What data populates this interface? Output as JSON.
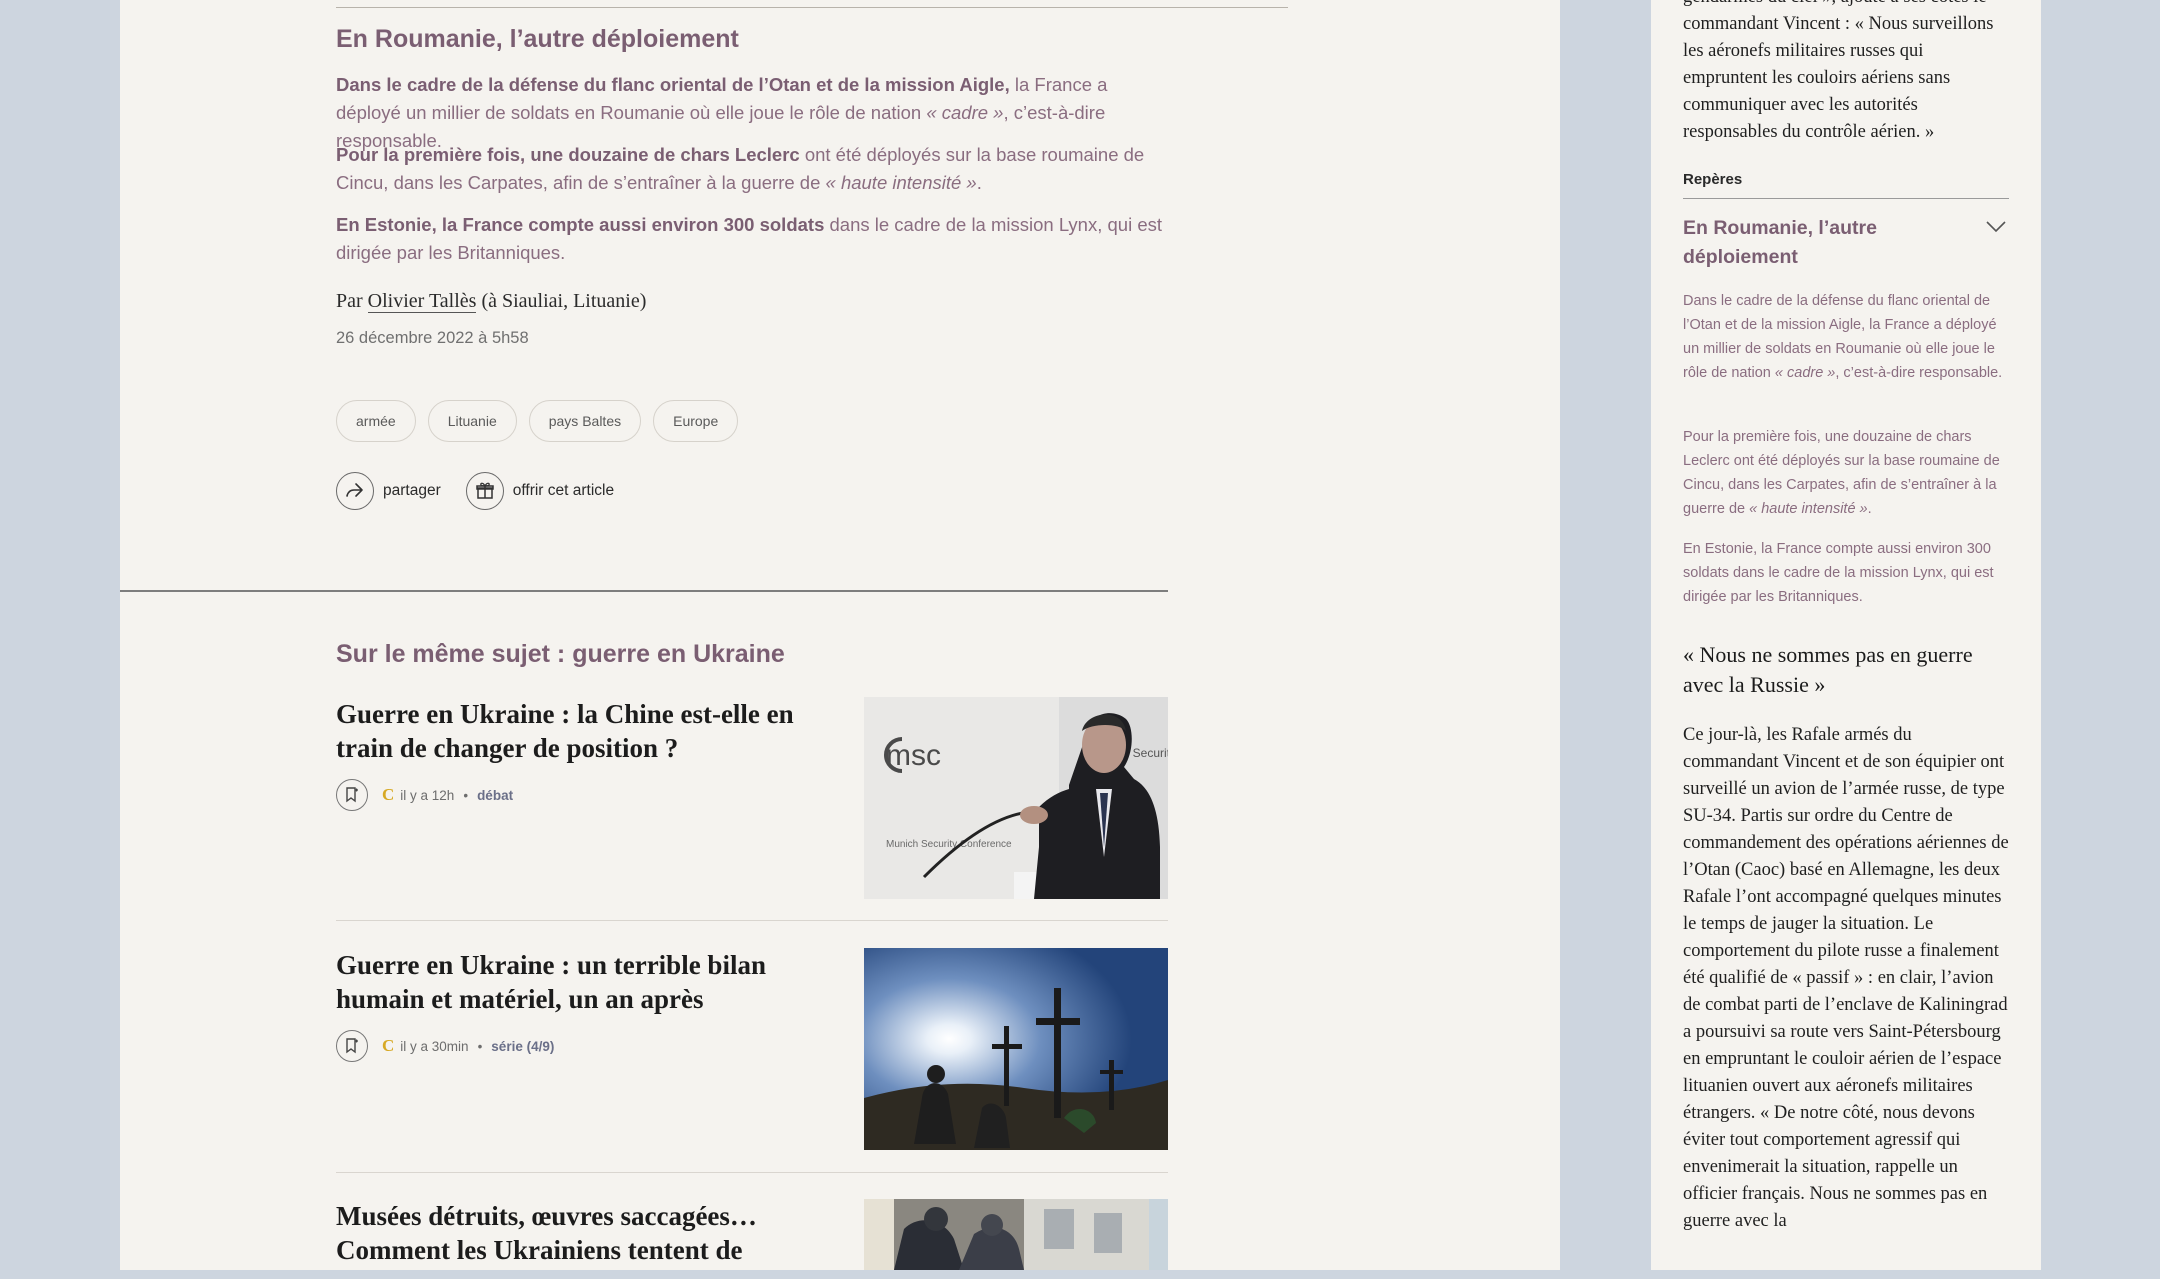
{
  "article": {
    "section_title": "En Roumanie, l’autre déploiement",
    "paragraphs": [
      {
        "bold": "Dans le cadre de la défense du flanc oriental de l’Otan et de la mission Aigle,",
        "pre": " la France a déployé un millier de soldats en Roumanie où elle joue le rôle de nation ",
        "em": "« cadre »",
        "post": ", c’est-à-dire responsable."
      },
      {
        "bold": "Pour la première fois, une douzaine de chars Leclerc",
        "pre": " ont été déployés sur la base roumaine de Cincu, dans les Carpates, afin de s’entraîner à la guerre de ",
        "em": "« haute intensité »",
        "post": "."
      },
      {
        "bold": "En Estonie, la France compte aussi environ 300 soldats",
        "pre": " dans le cadre de la mission Lynx, qui est dirigée par les Britanniques.",
        "em": "",
        "post": ""
      }
    ],
    "byline_prefix": "Par",
    "author": "Olivier Tallès",
    "byline_suffix": "(à Siauliai, Lituanie)",
    "date": "26 décembre 2022 à 5h58",
    "tags": [
      "armée",
      "Lituanie",
      "pays Baltes",
      "Europe"
    ],
    "share_label": "partager",
    "gift_label": "offrir cet article"
  },
  "related": {
    "title": "Sur le même sujet : guerre en Ukraine",
    "items": [
      {
        "title": "Guerre en Ukraine : la Chine est-elle en train de changer de position ?",
        "time": "il y a 12h",
        "kind": "débat",
        "brand": "C"
      },
      {
        "title": "Guerre en Ukraine : un terrible bilan humain et matériel, un an après",
        "time": "il y a 30min",
        "kind": "série (4/9)",
        "brand": "C"
      },
      {
        "title": "Musées détruits, œuvres saccagées… Comment les Ukrainiens tentent de",
        "time": "",
        "kind": "",
        "brand": ""
      }
    ],
    "thumb1_logo": "msc",
    "thumb1_sub": "Munich Security Conference",
    "thumb1_side": "ich Security"
  },
  "sidebar": {
    "top_text_line0": "gendarmes du ciel », ajoute à ses côtés le",
    "top_text": "commandant Vincent : « Nous surveillons les aéronefs militaires russes qui empruntent les couloirs aériens sans communiquer avec les autorités responsables du contrôle aérien. »",
    "reperes_label": "Repères",
    "accordion_title": "En Roumanie, l’autre déploiement",
    "small_paras": [
      {
        "pre": "Dans le cadre de la défense du flanc oriental de l’Otan et de la mission Aigle, la France a déployé un millier de soldats en Roumanie où elle joue le rôle de nation ",
        "em": "« cadre »",
        "post": ", c’est-à-dire responsable."
      },
      {
        "pre": "Pour la première fois, une douzaine de chars Leclerc ont été déployés sur la base roumaine de Cincu, dans les Carpates, afin de s’entraîner à la guerre de ",
        "em": "« haute intensité »",
        "post": "."
      },
      {
        "pre": "En Estonie, la France compte aussi environ 300 soldats dans le cadre de la mission Lynx, qui est dirigée par les Britanniques.",
        "em": "",
        "post": ""
      }
    ],
    "quote_title": "« Nous ne sommes pas en guerre avec la Russie »",
    "body": "Ce jour-là, les Rafale armés du commandant Vincent et de son équipier ont surveillé un avion de l’armée russe, de type SU-34. Partis sur ordre du Centre de commandement des opérations aériennes de l’Otan (Caoc) basé en Allemagne, les deux Rafale l’ont accompagné quelques minutes le temps de jauger la situation. Le comportement du pilote russe a finalement été qualifié de « passif » : en clair, l’avion de combat parti de l’enclave de Kaliningrad a poursuivi sa route vers Saint-Pétersbourg en empruntant le couloir aérien de l’espace lituanien ouvert aux aéronefs militaires étrangers. « De notre côté, nous devons éviter tout comportement agressif qui envenimerait la situation, rappelle un officier français. Nous ne sommes pas en guerre avec la"
  },
  "colors": {
    "accent": "#7a5e72",
    "brand_mark": "#d7a925",
    "page_bg": "#cdd5df",
    "panel_bg": "#f5f3ef"
  }
}
